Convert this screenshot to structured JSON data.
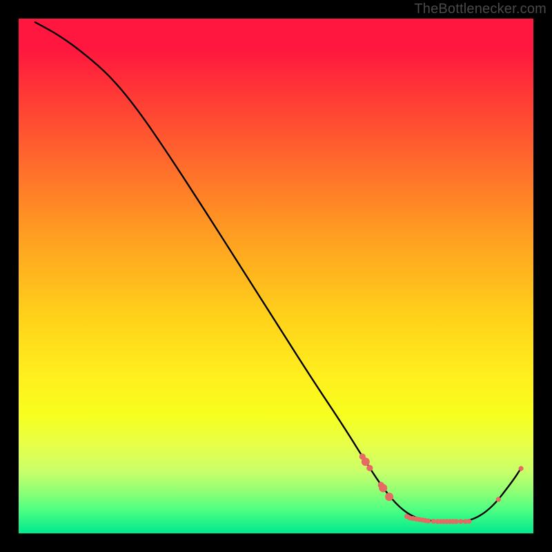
{
  "watermark": "TheBottlenecker.com",
  "chart_data": {
    "type": "line",
    "title": "",
    "xlabel": "",
    "ylabel": "",
    "xlim": [
      0,
      100
    ],
    "ylim": [
      0,
      100
    ],
    "grid": false,
    "line_color": "#000000",
    "marker_color": "#e56a63",
    "background": "rainbow-gradient",
    "curve_points": [
      {
        "x": 3.2,
        "y": 99.3
      },
      {
        "x": 8.0,
        "y": 96.7
      },
      {
        "x": 13.0,
        "y": 93.0
      },
      {
        "x": 18.0,
        "y": 88.6
      },
      {
        "x": 23.0,
        "y": 82.5
      },
      {
        "x": 29.0,
        "y": 73.8
      },
      {
        "x": 36.0,
        "y": 63.0
      },
      {
        "x": 43.0,
        "y": 52.0
      },
      {
        "x": 50.0,
        "y": 41.0
      },
      {
        "x": 57.0,
        "y": 30.0
      },
      {
        "x": 63.0,
        "y": 21.0
      },
      {
        "x": 68.0,
        "y": 13.0
      },
      {
        "x": 71.0,
        "y": 8.5
      },
      {
        "x": 74.0,
        "y": 5.0
      },
      {
        "x": 77.0,
        "y": 3.0
      },
      {
        "x": 80.0,
        "y": 2.4
      },
      {
        "x": 84.0,
        "y": 2.3
      },
      {
        "x": 88.0,
        "y": 2.4
      },
      {
        "x": 92.0,
        "y": 5.0
      },
      {
        "x": 96.0,
        "y": 10.2
      },
      {
        "x": 97.5,
        "y": 12.5
      }
    ],
    "markers": [
      {
        "x": 66.8,
        "y": 14.9,
        "r": 4.6
      },
      {
        "x": 67.4,
        "y": 13.9,
        "r": 6.0
      },
      {
        "x": 68.2,
        "y": 12.7,
        "r": 4.6
      },
      {
        "x": 70.4,
        "y": 9.4,
        "r": 4.6
      },
      {
        "x": 70.8,
        "y": 8.8,
        "r": 6.0
      },
      {
        "x": 72.0,
        "y": 7.1,
        "r": 6.0
      },
      {
        "x": 75.4,
        "y": 3.3,
        "r": 3.6
      },
      {
        "x": 76.0,
        "y": 3.0,
        "r": 3.6
      },
      {
        "x": 76.6,
        "y": 2.9,
        "r": 3.6
      },
      {
        "x": 77.2,
        "y": 2.8,
        "r": 3.6
      },
      {
        "x": 77.8,
        "y": 2.7,
        "r": 3.6
      },
      {
        "x": 78.4,
        "y": 2.6,
        "r": 3.6
      },
      {
        "x": 79.0,
        "y": 2.5,
        "r": 3.6
      },
      {
        "x": 79.6,
        "y": 2.4,
        "r": 3.6
      },
      {
        "x": 80.6,
        "y": 2.35,
        "r": 3.6
      },
      {
        "x": 81.4,
        "y": 2.3,
        "r": 3.6
      },
      {
        "x": 82.0,
        "y": 2.3,
        "r": 3.6
      },
      {
        "x": 82.6,
        "y": 2.3,
        "r": 3.6
      },
      {
        "x": 83.2,
        "y": 2.3,
        "r": 3.6
      },
      {
        "x": 83.8,
        "y": 2.3,
        "r": 3.6
      },
      {
        "x": 84.4,
        "y": 2.3,
        "r": 3.6
      },
      {
        "x": 85.0,
        "y": 2.3,
        "r": 3.6
      },
      {
        "x": 85.9,
        "y": 2.3,
        "r": 3.6
      },
      {
        "x": 86.8,
        "y": 2.3,
        "r": 3.6
      },
      {
        "x": 87.5,
        "y": 2.35,
        "r": 3.6
      },
      {
        "x": 93.2,
        "y": 6.6,
        "r": 3.6
      },
      {
        "x": 97.6,
        "y": 12.6,
        "r": 3.6
      }
    ]
  }
}
